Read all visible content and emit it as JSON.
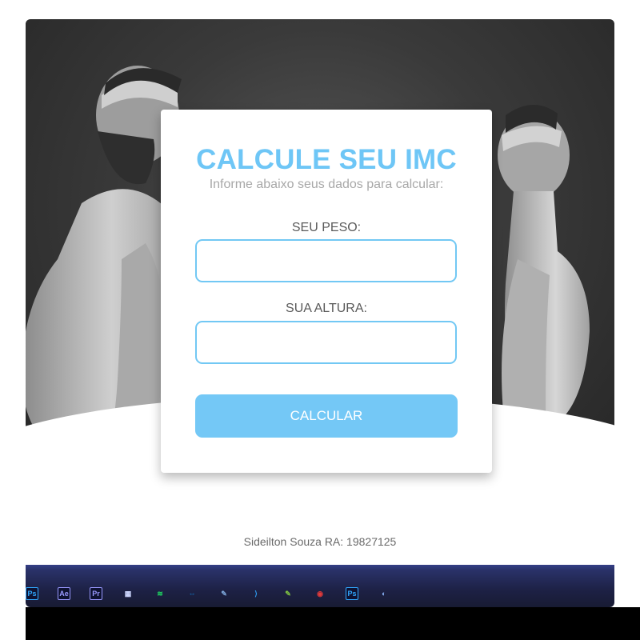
{
  "card": {
    "title": "CALCULE SEU IMC",
    "subtitle": "Informe abaixo seus dados para calcular:",
    "weight_label": "SEU PESO:",
    "height_label": "SUA ALTURA:",
    "weight_value": "",
    "height_value": "",
    "button_label": "CALCULAR"
  },
  "footer": {
    "credit": "Sideilton Souza RA: 19827125"
  },
  "taskbar": {
    "icons": [
      {
        "name": "photoshop-icon",
        "glyph": "Ps",
        "color": "#31a8ff"
      },
      {
        "name": "after-effects-icon",
        "glyph": "Ae",
        "color": "#9999ff"
      },
      {
        "name": "premiere-icon",
        "glyph": "Pr",
        "color": "#9999ff"
      },
      {
        "name": "app-icon",
        "glyph": "▦",
        "color": "#cfd8ff"
      },
      {
        "name": "spotify-icon",
        "glyph": "≋",
        "color": "#1ed760"
      },
      {
        "name": "teamviewer-icon",
        "glyph": "⇔",
        "color": "#0e8ee9"
      },
      {
        "name": "notepad-icon",
        "glyph": "✎",
        "color": "#7da7d9"
      },
      {
        "name": "vscode-icon",
        "glyph": "⟩",
        "color": "#2f9bf0"
      },
      {
        "name": "notepad-plus-icon",
        "glyph": "✎",
        "color": "#7ec242"
      },
      {
        "name": "media-player-icon",
        "glyph": "◉",
        "color": "#e33a3a"
      },
      {
        "name": "photoshop-2-icon",
        "glyph": "Ps",
        "color": "#31a8ff"
      },
      {
        "name": "browser-icon",
        "glyph": "◐",
        "color": "#8ab4f8"
      }
    ]
  }
}
